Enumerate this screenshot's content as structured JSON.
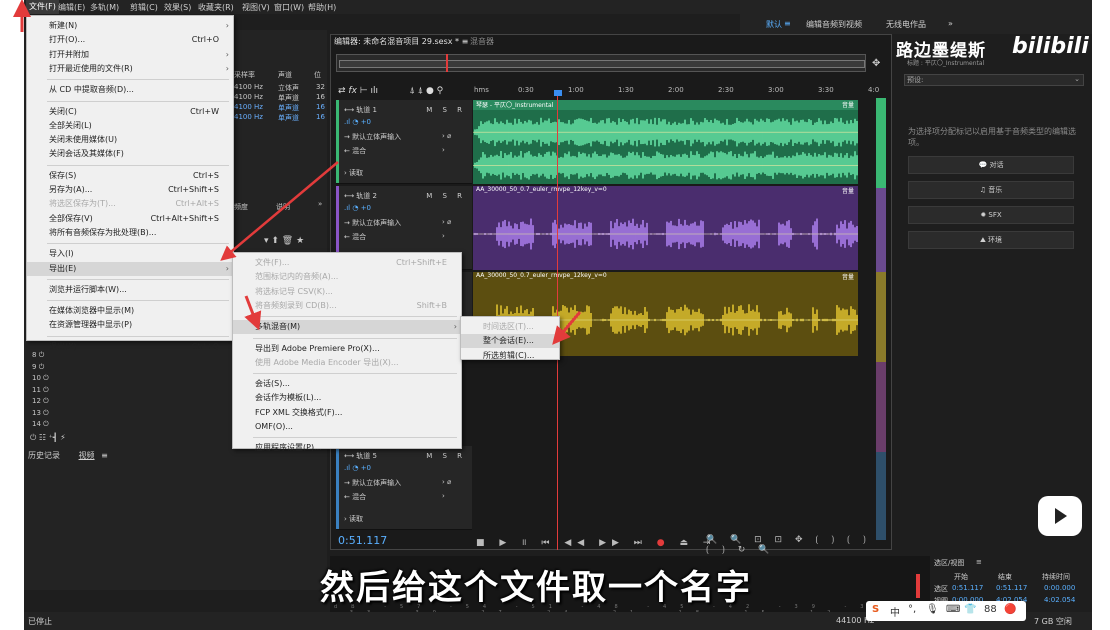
{
  "topmenu": [
    "文件(F)",
    "编辑(E)",
    "多轨(M)",
    "剪辑(C)",
    "效果(S)",
    "收藏夹(R)",
    "视图(V)",
    "窗口(W)",
    "帮助(H)"
  ],
  "workspace": {
    "default": "默认",
    "edit_audio": "编辑音频到视频",
    "radio": "无线电作品"
  },
  "file_menu": [
    {
      "label": "新建(N)",
      "shortcut": "",
      "sub": true,
      "dis": false
    },
    {
      "label": "打开(O)...",
      "shortcut": "Ctrl+O",
      "sub": false,
      "dis": false
    },
    {
      "label": "打开并附加",
      "shortcut": "",
      "sub": true,
      "dis": false
    },
    {
      "label": "打开最近使用的文件(R)",
      "shortcut": "",
      "sub": true,
      "dis": false
    },
    {
      "sep": true
    },
    {
      "label": "从 CD 中提取音频(D)...",
      "shortcut": "",
      "sub": false,
      "dis": false
    },
    {
      "sep": true
    },
    {
      "label": "关闭(C)",
      "shortcut": "Ctrl+W",
      "sub": false,
      "dis": false
    },
    {
      "label": "全部关闭(L)",
      "shortcut": "",
      "sub": false,
      "dis": false
    },
    {
      "label": "关闭未使用媒体(U)",
      "shortcut": "",
      "sub": false,
      "dis": false
    },
    {
      "label": "关闭会话及其媒体(F)",
      "shortcut": "",
      "sub": false,
      "dis": false
    },
    {
      "sep": true
    },
    {
      "label": "保存(S)",
      "shortcut": "Ctrl+S",
      "sub": false,
      "dis": false
    },
    {
      "label": "另存为(A)...",
      "shortcut": "Ctrl+Shift+S",
      "sub": false,
      "dis": false
    },
    {
      "label": "将选区保存为(T)...",
      "shortcut": "Ctrl+Alt+S",
      "sub": false,
      "dis": true
    },
    {
      "label": "全部保存(V)",
      "shortcut": "Ctrl+Alt+Shift+S",
      "sub": false,
      "dis": false
    },
    {
      "label": "将所有音频保存为批处理(B)...",
      "shortcut": "",
      "sub": false,
      "dis": false
    },
    {
      "sep": true
    },
    {
      "label": "导入(I)",
      "shortcut": "",
      "sub": true,
      "dis": false
    },
    {
      "label": "导出(E)",
      "shortcut": "",
      "sub": true,
      "dis": false,
      "hl": true
    },
    {
      "sep": true
    },
    {
      "label": "浏览并运行脚本(W)...",
      "shortcut": "",
      "sub": false,
      "dis": false
    },
    {
      "sep": true
    },
    {
      "label": "在媒体浏览器中显示(M)",
      "shortcut": "",
      "sub": false,
      "dis": false
    },
    {
      "label": "在资源管理器中显示(P)",
      "shortcut": "",
      "sub": false,
      "dis": false
    },
    {
      "sep": true
    },
    {
      "label": "退出(X)",
      "shortcut": "Ctrl+Q",
      "sub": false,
      "dis": false
    }
  ],
  "export_menu": [
    {
      "label": "文件(F)...",
      "shortcut": "Ctrl+Shift+E",
      "sub": false,
      "dis": true
    },
    {
      "label": "范围标记内的音频(A)...",
      "shortcut": "",
      "sub": false,
      "dis": true
    },
    {
      "label": "将选标记导 CSV(K)...",
      "shortcut": "",
      "sub": false,
      "dis": true
    },
    {
      "label": "将音频刻录到 CD(B)...",
      "shortcut": "Shift+B",
      "sub": false,
      "dis": true
    },
    {
      "sep": true
    },
    {
      "label": "多轨混音(M)",
      "shortcut": "",
      "sub": true,
      "dis": false,
      "hl": true
    },
    {
      "sep": true
    },
    {
      "label": "导出到 Adobe Premiere Pro(X)...",
      "shortcut": "",
      "sub": false,
      "dis": false
    },
    {
      "label": "使用 Adobe Media Encoder 导出(X)...",
      "shortcut": "",
      "sub": false,
      "dis": true
    },
    {
      "sep": true
    },
    {
      "label": "会话(S)...",
      "shortcut": "",
      "sub": false,
      "dis": false
    },
    {
      "label": "会话作为模板(L)...",
      "shortcut": "",
      "sub": false,
      "dis": false
    },
    {
      "label": "FCP XML 交换格式(F)...",
      "shortcut": "",
      "sub": false,
      "dis": false
    },
    {
      "label": "OMF(O)...",
      "shortcut": "",
      "sub": false,
      "dis": false
    },
    {
      "sep": true
    },
    {
      "label": "应用程序设置(P)...",
      "shortcut": "",
      "sub": false,
      "dis": false
    }
  ],
  "mix_menu": [
    {
      "label": "时间选区(T)...",
      "shortcut": "",
      "sub": false,
      "dis": true
    },
    {
      "label": "整个会话(E)...",
      "shortcut": "",
      "sub": false,
      "dis": false,
      "hl": true
    },
    {
      "label": "所选剪辑(C)...",
      "shortcut": "",
      "sub": false,
      "dis": false
    }
  ],
  "files": {
    "headers": [
      "采样率",
      "声道",
      "位"
    ],
    "rows": [
      {
        "rate": "4100 Hz",
        "ch": "立体声",
        "bits": "32",
        "sel": false
      },
      {
        "rate": "4100 Hz",
        "ch": "单声道",
        "bits": "16",
        "sel": false
      },
      {
        "rate": "4100 Hz",
        "ch": "单声道",
        "bits": "16",
        "sel": true
      },
      {
        "rate": "4100 Hz",
        "ch": "单声道",
        "bits": "16",
        "sel": true
      }
    ]
  },
  "left_hdr": {
    "c1": "频度",
    "c2": "说明"
  },
  "track_numbers": [
    "8",
    "9",
    "10",
    "11",
    "12",
    "13",
    "14"
  ],
  "bottom_tabs": {
    "history": "历史记录",
    "video": "视频"
  },
  "editor": {
    "tab": "编辑器: 未命名混音项目 29.sesx *",
    "tab2": "混音器"
  },
  "ruler": [
    "hms",
    "0:30",
    "1:00",
    "1:30",
    "2:00",
    "2:30",
    "3:00",
    "3:30",
    "4:0"
  ],
  "tracks": [
    {
      "name": "轨道 1",
      "vol": "+0",
      "input": "默认立体声输入",
      "mix": "混合",
      "read": "读取",
      "clip": "琴瑟 - 平仄〇_Instrumental",
      "color": "#3ab873"
    },
    {
      "name": "轨道 2",
      "vol": "+0",
      "input": "默认立体声输入",
      "mix": "混合",
      "read": "读取",
      "clip": "AA_30000_50_0.7_euler_rmvpe_12key_v=0",
      "color": "#8a55c7"
    },
    {
      "name": "轨道 3",
      "vol": "+0",
      "input": "默认立体声输入",
      "mix": "混合",
      "read": "读取",
      "clip": "AA_30000_50_0.7_euler_rmvpe_12key_v=0",
      "color": "#c9a714"
    },
    {
      "name": "轨道 5",
      "vol": "+0",
      "input": "默认立体声输入",
      "mix": "混合",
      "read": "读取",
      "clip": "",
      "color": "#3a80c0"
    }
  ],
  "clip_vol": "音量",
  "transport_time": "0:51.117",
  "right_panel": {
    "preset": "预设:",
    "desc": "为选择项分配标记以启用基于音频类型的编辑选项。",
    "buttons": [
      "对话",
      "音乐",
      "SFX",
      "环境"
    ]
  },
  "logo": {
    "text": "路边墨缇斯",
    "sub": "标题 : 平仄〇_Instrumental",
    "bili": "bilibili"
  },
  "selection": {
    "title": "选区/视图",
    "headers": [
      "开始",
      "结束",
      "持续时间"
    ],
    "sel_label": "选区",
    "sel": [
      "0:51.117",
      "0:51.117",
      "0:00.000"
    ],
    "view_label": "视图",
    "view": [
      "0:00.000",
      "4:02.054",
      "4:02.054"
    ]
  },
  "statusbar": {
    "left": "已停止",
    "rate": "44100 Hz",
    "space": "7 GB 空闲"
  },
  "subtitle": "然后给这个文件取一个名字",
  "ime": [
    "S",
    "中",
    "°,",
    "🎙",
    "⌨",
    "👕",
    "88",
    "🔴"
  ],
  "colors": {
    "accent": "#5ab0ff",
    "green": "#3ab873",
    "purple": "#8a55c7",
    "gold": "#c9a714",
    "arrow": "#e23b3b"
  }
}
